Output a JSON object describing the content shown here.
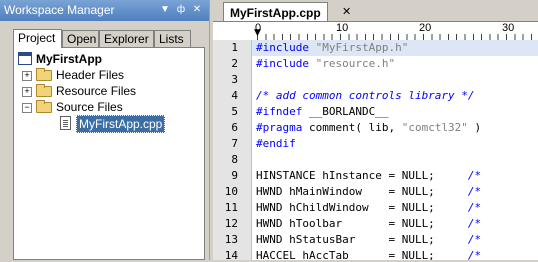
{
  "workspace": {
    "title": "Workspace Manager",
    "tabs": [
      "Project",
      "Open",
      "Explorer",
      "Lists"
    ],
    "tree": {
      "root": "MyFirstApp",
      "folders": [
        "Header Files",
        "Resource Files",
        "Source Files"
      ],
      "selected_file": "MyFirstApp.cpp"
    }
  },
  "editor": {
    "tab_title": "MyFirstApp.cpp",
    "ruler_labels": [
      "0",
      "10",
      "20",
      "30"
    ],
    "line_numbers": [
      "1",
      "2",
      "3",
      "4",
      "5",
      "6",
      "7",
      "8",
      "9",
      "10",
      "11",
      "12",
      "13",
      "14"
    ],
    "lines": [
      [
        {
          "t": "#include ",
          "c": "kw"
        },
        {
          "t": "\"MyFirstApp.h\"",
          "c": "str"
        }
      ],
      [
        {
          "t": "#include ",
          "c": "kw"
        },
        {
          "t": "\"resource.h\"",
          "c": "str"
        }
      ],
      [],
      [
        {
          "t": "/* add common controls library */",
          "c": "cm"
        }
      ],
      [
        {
          "t": "#ifndef ",
          "c": "kw"
        },
        {
          "t": "__BORLANDC__",
          "c": ""
        }
      ],
      [
        {
          "t": "#pragma ",
          "c": "kw"
        },
        {
          "t": "comment( lib, ",
          "c": ""
        },
        {
          "t": "\"comctl32\"",
          "c": "str"
        },
        {
          "t": " )",
          "c": ""
        }
      ],
      [
        {
          "t": "#endif",
          "c": "kw"
        }
      ],
      [],
      [
        {
          "t": "HINSTANCE hInstance = NULL;     ",
          "c": ""
        },
        {
          "t": "/*",
          "c": "cm"
        }
      ],
      [
        {
          "t": "HWND hMainWindow    = NULL;     ",
          "c": ""
        },
        {
          "t": "/*",
          "c": "cm"
        }
      ],
      [
        {
          "t": "HWND hChildWindow   = NULL;     ",
          "c": ""
        },
        {
          "t": "/*",
          "c": "cm"
        }
      ],
      [
        {
          "t": "HWND hToolbar       = NULL;     ",
          "c": ""
        },
        {
          "t": "/*",
          "c": "cm"
        }
      ],
      [
        {
          "t": "HWND hStatusBar     = NULL;     ",
          "c": ""
        },
        {
          "t": "/*",
          "c": "cm"
        }
      ],
      [
        {
          "t": "HACCEL hAccTab      = NULL;     ",
          "c": ""
        },
        {
          "t": "/*",
          "c": "cm"
        }
      ]
    ]
  }
}
